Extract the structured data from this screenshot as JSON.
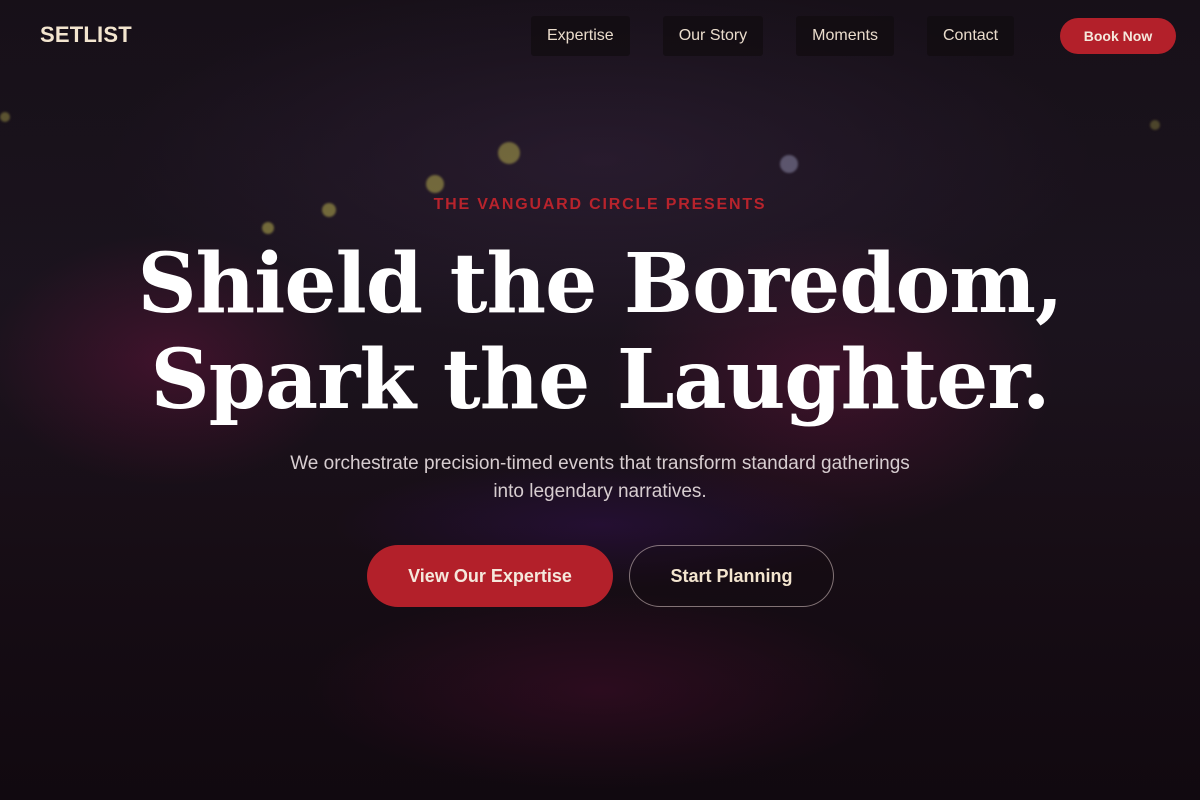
{
  "header": {
    "logo": "SETLIST",
    "nav": [
      {
        "label": "Expertise"
      },
      {
        "label": "Our Story"
      },
      {
        "label": "Moments"
      },
      {
        "label": "Contact"
      }
    ],
    "book_label": "Book Now"
  },
  "hero": {
    "eyebrow": "THE VANGUARD CIRCLE PRESENTS",
    "headline_line1": "Shield the Boredom,",
    "headline_line2": "Spark the Laughter.",
    "subtitle": "We orchestrate precision-timed events that transform standard gatherings into legendary narratives.",
    "primary_cta": "View Our Expertise",
    "secondary_cta": "Start Planning"
  },
  "colors": {
    "accent": "#b3202a",
    "logo": "#f3e5cf",
    "background": "#1a0f18"
  }
}
